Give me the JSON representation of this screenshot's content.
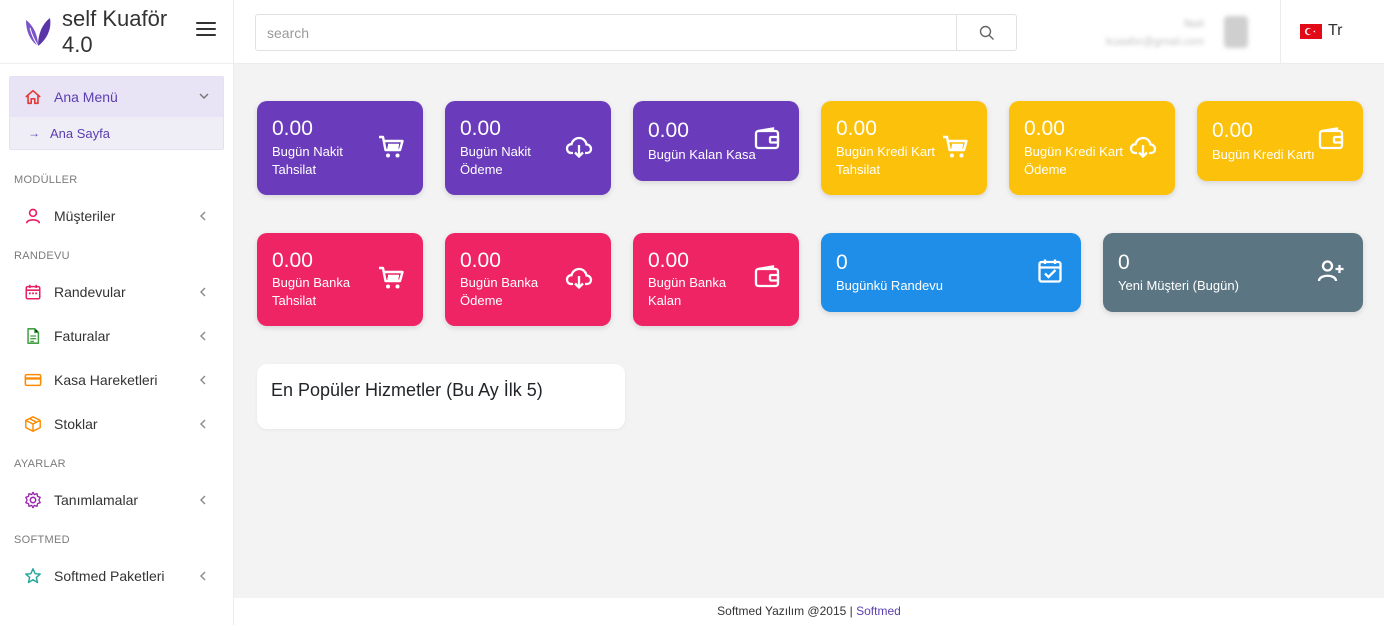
{
  "brand": {
    "name": "self Kuaför 4.0"
  },
  "search": {
    "placeholder": "search"
  },
  "user": {
    "name": "Nuri",
    "email": "kuaafor@gmail.com"
  },
  "language": {
    "label": "Tr"
  },
  "sidebar": {
    "main_menu": {
      "label": "Ana Menü",
      "sub_label": "Ana Sayfa"
    },
    "sections": [
      {
        "title": "MODÜLLER",
        "items": [
          {
            "label": "Müşteriler",
            "icon": "user-icon"
          }
        ]
      },
      {
        "title": "RANDEVU",
        "items": [
          {
            "label": "Randevular",
            "icon": "calendar-icon"
          },
          {
            "label": "Faturalar",
            "icon": "document-icon"
          },
          {
            "label": "Kasa Hareketleri",
            "icon": "credit-card-icon"
          },
          {
            "label": "Stoklar",
            "icon": "box-icon"
          }
        ]
      },
      {
        "title": "AYARLAR",
        "items": [
          {
            "label": "Tanımlamalar",
            "icon": "gear-icon"
          }
        ]
      },
      {
        "title": "SOFTMED",
        "items": [
          {
            "label": "Softmed Paketleri",
            "icon": "star-icon"
          }
        ]
      }
    ]
  },
  "cards": [
    {
      "value": "0.00",
      "label": "Bugün Nakit Tahsilat",
      "icon": "cart-icon",
      "color": "#6a3bbb"
    },
    {
      "value": "0.00",
      "label": "Bugün Nakit Ödeme",
      "icon": "cloud-download-icon",
      "color": "#6a3bbb"
    },
    {
      "value": "0.00",
      "label": "Bugün Kalan Kasa",
      "icon": "wallet-icon",
      "color": "#6a3bbb"
    },
    {
      "value": "0.00",
      "label": "Bugün Kredi Kart Tahsilat",
      "icon": "cart-icon",
      "color": "#fcc10b"
    },
    {
      "value": "0.00",
      "label": "Bugün Kredi Kart Ödeme",
      "icon": "cloud-download-icon",
      "color": "#fcc10b"
    },
    {
      "value": "0.00",
      "label": "Bugün Kredi Kartı",
      "icon": "wallet-icon",
      "color": "#fcc10b"
    },
    {
      "value": "0.00",
      "label": "Bugün Banka Tahsilat",
      "icon": "cart-icon",
      "color": "#ef2465"
    },
    {
      "value": "0.00",
      "label": "Bugün Banka Ödeme",
      "icon": "cloud-download-icon",
      "color": "#ef2465"
    },
    {
      "value": "0.00",
      "label": "Bugün Banka Kalan",
      "icon": "wallet-icon",
      "color": "#ef2465"
    },
    {
      "value": "0",
      "label": "Bugünkü Randevu",
      "icon": "calendar-check-icon",
      "color": "#1e8ee8"
    },
    {
      "value": "0",
      "label": "Yeni Müşteri (Bugün)",
      "icon": "add-user-icon",
      "color": "#5c7583"
    }
  ],
  "popular": {
    "title": "En Popüler Hizmetler (Bu Ay İlk 5)"
  },
  "footer": {
    "text": "Softmed Yazılım @2015 |",
    "link": "Softmed"
  }
}
